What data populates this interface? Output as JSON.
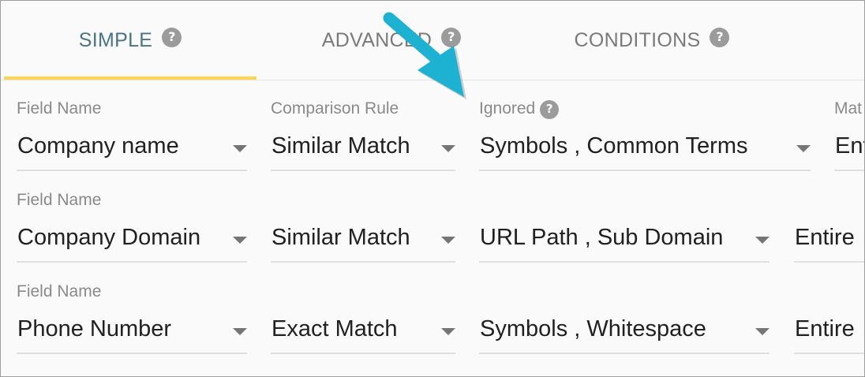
{
  "tabs": [
    {
      "label": "SIMPLE",
      "help_glyph": "?",
      "active": true
    },
    {
      "label": "ADVANCED",
      "help_glyph": "?",
      "active": false
    },
    {
      "label": "CONDITIONS",
      "help_glyph": "?",
      "active": false
    }
  ],
  "rows": [
    {
      "field_name_label": "Field Name",
      "field_value": "Company name",
      "comparison_label": "Comparison Rule",
      "comparison_value": "Similar Match",
      "ignored_label": "Ignored",
      "ignored_help_glyph": "?",
      "ignored_value": "Symbols , Common Terms",
      "match_label": "Mat",
      "match_value": "Ent"
    },
    {
      "field_name_label": "Field Name",
      "field_value": "Company Domain",
      "comparison_value": "Similar Match",
      "ignored_value": "URL Path , Sub Domain",
      "match_value": "Entire"
    },
    {
      "field_name_label": "Field Name",
      "field_value": "Phone Number",
      "comparison_value": "Exact Match",
      "ignored_value": "Symbols , Whitespace",
      "match_value": "Entire"
    }
  ],
  "annotation": {
    "color": "#1db1d2",
    "icon": "arrow-icon"
  },
  "colors": {
    "active_tab": "#4a7486",
    "tab_indicator": "#ffd54f",
    "help_icon": "#9b9b9b"
  }
}
